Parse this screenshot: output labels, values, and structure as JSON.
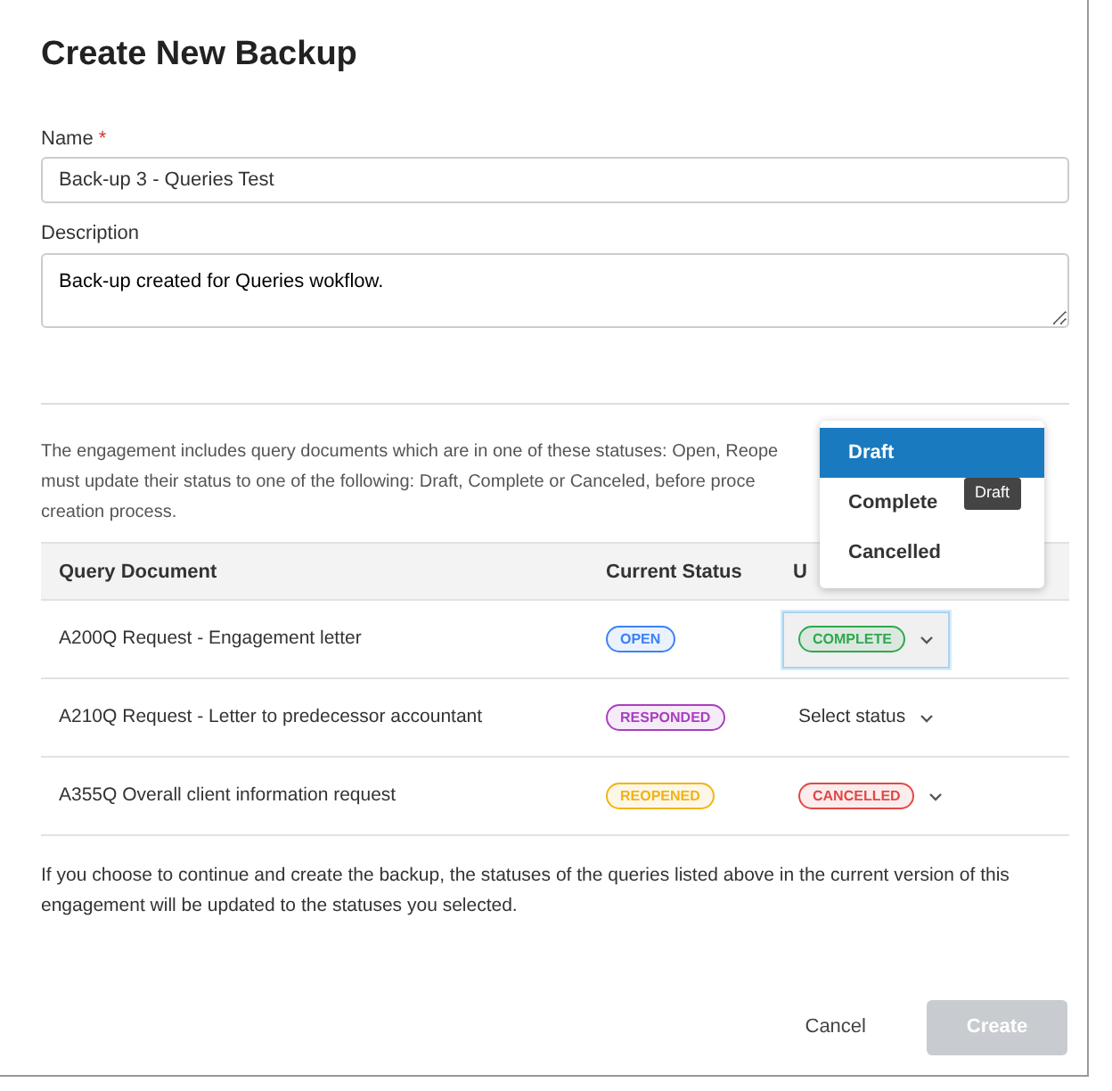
{
  "title": "Create New Backup",
  "name_field": {
    "label": "Name",
    "required_mark": "*",
    "value": "Back-up 3 - Queries Test"
  },
  "description_field": {
    "label": "Description",
    "value": "Back-up created for Queries wokflow."
  },
  "intro_lines": [
    "The engagement includes query documents which are in one of these statuses: Open, Reope",
    "must update their status to one of the following: Draft, Complete or Canceled, before proce",
    "creation process."
  ],
  "table": {
    "columns": [
      "Query Document",
      "Current Status",
      "U"
    ],
    "rows": [
      {
        "document": "A200Q Request - Engagement letter",
        "current_status": {
          "label": "OPEN",
          "color": "#3b82f6"
        },
        "update": {
          "kind": "badge",
          "label": "COMPLETE",
          "color": "#2fa84f"
        },
        "focused": true
      },
      {
        "document": "A210Q Request - Letter to predecessor accountant",
        "current_status": {
          "label": "RESPONDED",
          "color": "#a83fbf"
        },
        "update": {
          "kind": "placeholder",
          "label": "Select status"
        },
        "focused": false
      },
      {
        "document": "A355Q Overall client information request",
        "current_status": {
          "label": "REOPENED",
          "color": "#f2b312"
        },
        "update": {
          "kind": "badge",
          "label": "CANCELLED",
          "color": "#e04848"
        },
        "focused": false
      }
    ]
  },
  "status_menu": {
    "items": [
      {
        "label": "Draft",
        "selected": true
      },
      {
        "label": "Complete",
        "selected": false
      },
      {
        "label": "Cancelled",
        "selected": false
      }
    ],
    "tooltip": "Draft"
  },
  "footer_note": "If you choose to continue and create the backup, the statuses of the queries listed above in the current version of this engagement will be updated to the statuses you selected.",
  "buttons": [
    {
      "label": "Cancel",
      "kind": "link"
    },
    {
      "label": "Create",
      "kind": "primary",
      "disabled": true
    }
  ]
}
